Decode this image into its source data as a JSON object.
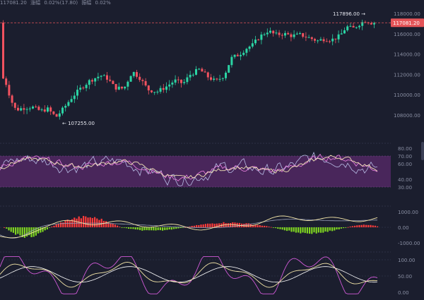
{
  "header": {
    "price": "117081.20",
    "change_label": "涨幅",
    "change": "0.02%(17.80)",
    "amplitude_label": "振幅",
    "amplitude": "0.02%"
  },
  "price_chart": {
    "axis_ticks": [
      "118000.00",
      "116000.00",
      "114000.00",
      "112000.00",
      "110000.00",
      "108000.00"
    ],
    "current_price_tag": "117081.20",
    "high_marker": "117896.00 →",
    "low_marker": "← 107255.00",
    "colors": {
      "up": "#2bd4a4",
      "down": "#f2525f",
      "tag": "#e45458"
    }
  },
  "rsi_panel": {
    "axis_ticks": [
      "80.00",
      "70.00",
      "60.00",
      "40.00",
      "30.00"
    ],
    "colors": {
      "band": "#5a2a6b",
      "line_fast": "#f0e2b4",
      "line_mid": "#e07ad8",
      "line_slow": "#b8bde6"
    }
  },
  "macd_panel": {
    "axis_ticks": [
      "1000.00",
      "0.00",
      "-1000.00"
    ],
    "colors": {
      "pos": "#ff3b3b",
      "neg": "#7ed321",
      "dif": "#f3e5a8",
      "dea": "#9aa0b8"
    }
  },
  "kdj_panel": {
    "axis_ticks": [
      "100.00",
      "50.00",
      "0.00"
    ],
    "colors": {
      "k": "#f3e5a8",
      "d": "#ffffff",
      "j": "#d15ad8"
    }
  }
}
